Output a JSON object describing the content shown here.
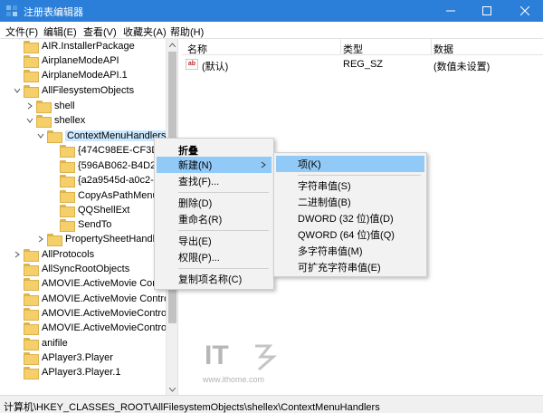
{
  "window": {
    "title": "注册表编辑器"
  },
  "menubar": [
    "文件(F)",
    "编辑(E)",
    "查看(V)",
    "收藏夹(A)",
    "帮助(H)"
  ],
  "tree": [
    {
      "label": "AIR.InstallerPackage"
    },
    {
      "label": "AirplaneModeAPI"
    },
    {
      "label": "AirplaneModeAPI.1"
    },
    {
      "label": "AllFilesystemObjects"
    },
    {
      "label": "shell"
    },
    {
      "label": "shellex"
    },
    {
      "label": "ContextMenuHandlers"
    },
    {
      "label": "{474C98EE-CF3D-"
    },
    {
      "label": "{596AB062-B4D2-"
    },
    {
      "label": "{a2a9545d-a0c2-"
    },
    {
      "label": "CopyAsPathMenu"
    },
    {
      "label": "QQShellExt"
    },
    {
      "label": "SendTo"
    },
    {
      "label": "PropertySheetHandl"
    },
    {
      "label": "AllProtocols"
    },
    {
      "label": "AllSyncRootObjects"
    },
    {
      "label": "AMOVIE.ActiveMovie Contr"
    },
    {
      "label": "AMOVIE.ActiveMovie Control."
    },
    {
      "label": "AMOVIE.ActiveMovieControl"
    },
    {
      "label": "AMOVIE.ActiveMovieControl.2"
    },
    {
      "label": "anifile"
    },
    {
      "label": "APlayer3.Player"
    },
    {
      "label": "APlayer3.Player.1"
    }
  ],
  "list": {
    "headers": [
      "名称",
      "类型",
      "数据"
    ],
    "rows": [
      {
        "name": "(默认)",
        "type": "REG_SZ",
        "data": "(数值未设置)"
      }
    ]
  },
  "context_menu": {
    "items": [
      "折叠",
      "新建(N)",
      "查找(F)...",
      "删除(D)",
      "重命名(R)",
      "导出(E)",
      "权限(P)...",
      "复制项名称(C)"
    ]
  },
  "submenu": {
    "items": [
      "项(K)",
      "字符串值(S)",
      "二进制值(B)",
      "DWORD (32 位)值(D)",
      "QWORD (64 位)值(Q)",
      "多字符串值(M)",
      "可扩充字符串值(E)"
    ]
  },
  "status": {
    "path": "计算机\\HKEY_CLASSES_ROOT\\AllFilesystemObjects\\shellex\\ContextMenuHandlers"
  },
  "watermark": {
    "brand": "IT",
    "url": "www.ithome.com"
  },
  "colors": {
    "titlebar": "#2b7fd9",
    "highlight": "#91c9f7",
    "selected": "#cce8ff",
    "folder": "#f4cf6a"
  }
}
